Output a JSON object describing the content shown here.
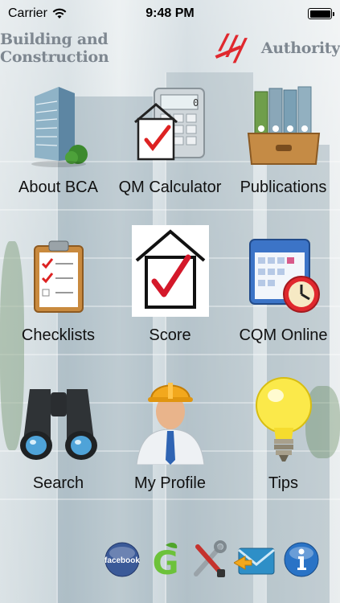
{
  "status": {
    "carrier": "Carrier",
    "time": "9:48 PM"
  },
  "banner": {
    "left_text": "Building and Construction",
    "right_text": "Authority"
  },
  "grid": [
    {
      "label": "About BCA",
      "icon": "building-icon"
    },
    {
      "label": "QM Calculator",
      "icon": "calculator-icon"
    },
    {
      "label": "Publications",
      "icon": "binders-icon"
    },
    {
      "label": "Checklists",
      "icon": "clipboard-icon"
    },
    {
      "label": "Score",
      "icon": "house-check-icon"
    },
    {
      "label": "CQM Online",
      "icon": "calendar-clock-icon"
    },
    {
      "label": "Search",
      "icon": "binoculars-icon"
    },
    {
      "label": "My Profile",
      "icon": "engineer-icon"
    },
    {
      "label": "Tips",
      "icon": "lightbulb-icon"
    }
  ],
  "bottom": {
    "facebook_label": "facebook",
    "green_label": "G"
  },
  "colors": {
    "brand_red": "#e0282e",
    "banner_gray": "#7e8790"
  }
}
